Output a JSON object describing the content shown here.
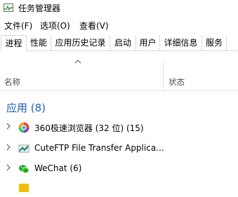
{
  "window": {
    "title": "任务管理器"
  },
  "menu": [
    "文件(F)",
    "选项(O)",
    "查看(V)"
  ],
  "tabs": [
    {
      "label": "进程",
      "active": true
    },
    {
      "label": "性能",
      "active": false
    },
    {
      "label": "应用历史记录",
      "active": false
    },
    {
      "label": "启动",
      "active": false
    },
    {
      "label": "用户",
      "active": false
    },
    {
      "label": "详细信息",
      "active": false
    },
    {
      "label": "服务",
      "active": false
    }
  ],
  "columns": {
    "name": "名称",
    "status": "状态"
  },
  "group": {
    "title": "应用 (8)"
  },
  "rows": [
    {
      "label": "360极速浏览器 (32 位) (15)",
      "icon": "360-browser-icon"
    },
    {
      "label": "CuteFTP File Transfer Applica...",
      "icon": "cuteftp-icon"
    },
    {
      "label": "WeChat (6)",
      "icon": "wechat-icon"
    }
  ],
  "colors": {
    "accent": "#1a5fb4",
    "divider": "#d9d9d9"
  }
}
